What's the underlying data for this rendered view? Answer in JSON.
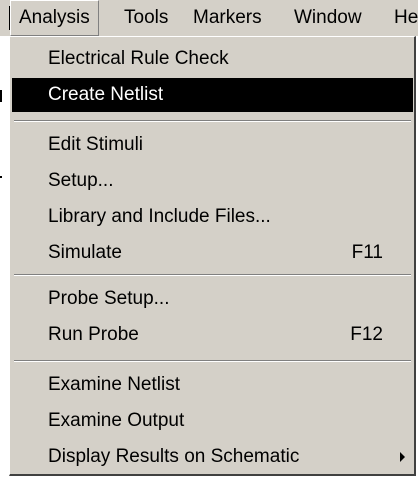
{
  "menubar": {
    "items": [
      {
        "label": "Analysis",
        "active": true
      },
      {
        "label": "Tools"
      },
      {
        "label": "Markers"
      },
      {
        "label": "Window"
      },
      {
        "label": "He"
      }
    ]
  },
  "analysis_menu": {
    "groups": [
      [
        {
          "label": "Electrical Rule Check",
          "shortcut": ""
        },
        {
          "label": "Create Netlist",
          "shortcut": "",
          "highlighted": true
        }
      ],
      [
        {
          "label": "Edit Stimuli",
          "shortcut": ""
        },
        {
          "label": "Setup...",
          "shortcut": ""
        },
        {
          "label": "Library and Include Files...",
          "shortcut": ""
        },
        {
          "label": "Simulate",
          "shortcut": "F11"
        }
      ],
      [
        {
          "label": "Probe Setup...",
          "shortcut": ""
        },
        {
          "label": "Run Probe",
          "shortcut": "F12"
        }
      ],
      [
        {
          "label": "Examine Netlist",
          "shortcut": ""
        },
        {
          "label": "Examine Output",
          "shortcut": ""
        },
        {
          "label": "Display Results on Schematic",
          "shortcut": "",
          "submenu_icon": "chevron-right-icon"
        }
      ]
    ]
  },
  "colors": {
    "menu_background": "#d4d0c8",
    "highlight_background": "#000000",
    "highlight_text": "#ffffff"
  }
}
